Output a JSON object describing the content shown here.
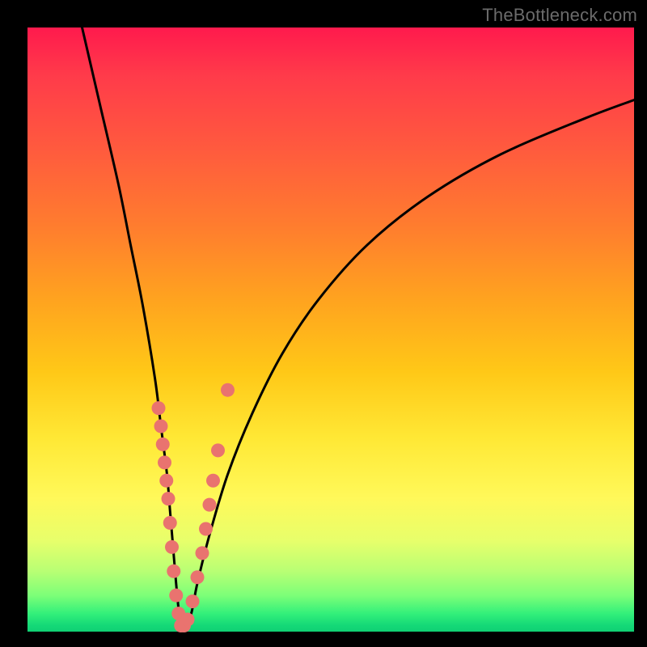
{
  "watermark": "TheBottleneck.com",
  "chart_data": {
    "type": "line",
    "title": "",
    "xlabel": "",
    "ylabel": "",
    "xlim": [
      0,
      100
    ],
    "ylim": [
      0,
      100
    ],
    "series": [
      {
        "name": "bottleneck-curve",
        "x": [
          9,
          12,
          15,
          17,
          19,
          21,
          22,
          23,
          23.5,
          24,
          24.5,
          25,
          25.5,
          26,
          27,
          28,
          30,
          33,
          37,
          42,
          48,
          56,
          66,
          78,
          92,
          100
        ],
        "y": [
          100,
          87,
          74,
          64,
          54,
          42,
          34,
          26,
          20,
          14,
          8,
          3,
          1,
          1,
          3,
          8,
          16,
          26,
          36,
          46,
          55,
          64,
          72,
          79,
          85,
          88
        ]
      }
    ],
    "markers": {
      "name": "highlight-dots",
      "x": [
        21.6,
        22.0,
        22.3,
        22.6,
        22.9,
        23.2,
        23.5,
        23.8,
        24.1,
        24.5,
        24.9,
        25.3,
        25.8,
        26.4,
        27.2,
        28.0,
        28.8,
        29.4,
        30.0,
        30.6,
        31.4,
        33.0
      ],
      "y": [
        37,
        34,
        31,
        28,
        25,
        22,
        18,
        14,
        10,
        6,
        3,
        1,
        1,
        2,
        5,
        9,
        13,
        17,
        21,
        25,
        30,
        40
      ]
    },
    "gradient_stops": [
      {
        "pos": 0.0,
        "color": "#ff1a4d"
      },
      {
        "pos": 0.33,
        "color": "#ff7d2e"
      },
      {
        "pos": 0.57,
        "color": "#ffc817"
      },
      {
        "pos": 0.78,
        "color": "#fff95a"
      },
      {
        "pos": 0.94,
        "color": "#7dff78"
      },
      {
        "pos": 1.0,
        "color": "#10d074"
      }
    ]
  }
}
